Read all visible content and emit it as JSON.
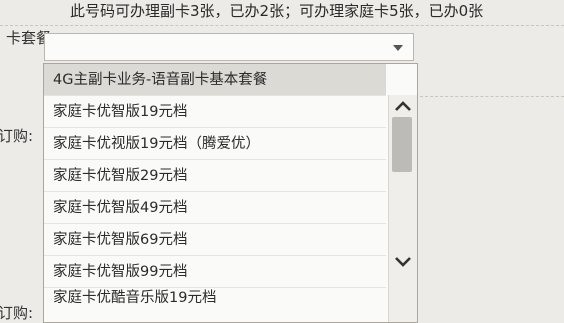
{
  "notice": "此号码可办理副卡3张，已办2张；可办理家庭卡5张，已办0张",
  "labels": {
    "card_plan": "卡套餐",
    "subscribe": "订购:",
    "subscribe_bottom": "订购:"
  },
  "select": {
    "value": ""
  },
  "dropdown": {
    "options": [
      "4G主副卡业务-语音副卡基本套餐",
      "家庭卡优智版19元档",
      "家庭卡优视版19元档（腾爱优）",
      "家庭卡优智版29元档",
      "家庭卡优智版49元档",
      "家庭卡优智版69元档",
      "家庭卡优智版99元档",
      "家庭卡优酷音乐版19元档"
    ],
    "selected_index": 0
  },
  "colors": {
    "page_bg": "#ecebe7",
    "selected_bg": "#dcdad4",
    "scroll_thumb": "#bdbbb5"
  },
  "icons": {
    "select_arrow": "caret-down-icon",
    "scroll_up": "chevron-up-icon",
    "scroll_down": "chevron-down-icon"
  }
}
